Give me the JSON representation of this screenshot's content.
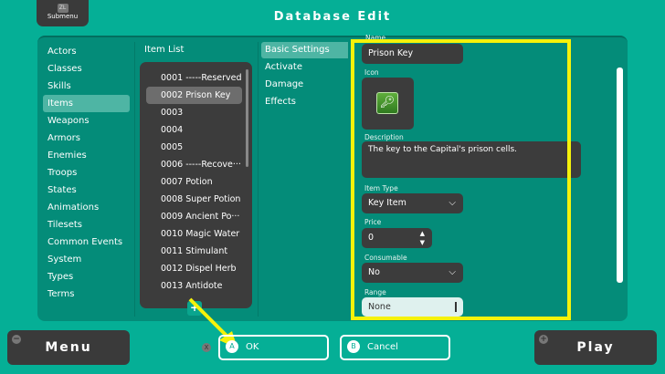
{
  "header": {
    "submenu_key": "ZL",
    "submenu_label": "Submenu",
    "title": "Database Edit"
  },
  "categories": [
    "Actors",
    "Classes",
    "Skills",
    "Items",
    "Weapons",
    "Armors",
    "Enemies",
    "Troops",
    "States",
    "Animations",
    "Tilesets",
    "Common Events",
    "System",
    "Types",
    "Terms"
  ],
  "selected_category": "Items",
  "item_list": {
    "header": "Item List",
    "items": [
      "0001 -----Reserved",
      "0002 Prison Key",
      "0003",
      "0004",
      "0005",
      "0006 -----Recove···",
      "0007 Potion",
      "0008 Super Potion",
      "0009 Ancient Po···",
      "0010 Magic Water",
      "0011 Stimulant",
      "0012 Dispel Herb",
      "0013 Antidote"
    ],
    "selected": "0002 Prison Key",
    "add": "+"
  },
  "tabs": [
    "Basic Settings",
    "Activate",
    "Damage",
    "Effects"
  ],
  "form": {
    "name_label": "Name",
    "name": "Prison Key",
    "icon_label": "Icon",
    "description_label": "Description",
    "description": "The key to the Capital's prison cells.",
    "item_type_label": "Item Type",
    "item_type": "Key Item",
    "price_label": "Price",
    "price": "0",
    "consumable_label": "Consumable",
    "consumable": "No",
    "range_label": "Range",
    "range": "None"
  },
  "footer": {
    "menu": "Menu",
    "menu_key": "−",
    "x_key": "X",
    "ok_key": "A",
    "ok": "OK",
    "cancel_key": "B",
    "cancel": "Cancel",
    "play": "Play",
    "play_key": "+"
  },
  "colors": {
    "background": "#05af96",
    "panel": "#048c79",
    "highlight": "#f5f20a"
  }
}
